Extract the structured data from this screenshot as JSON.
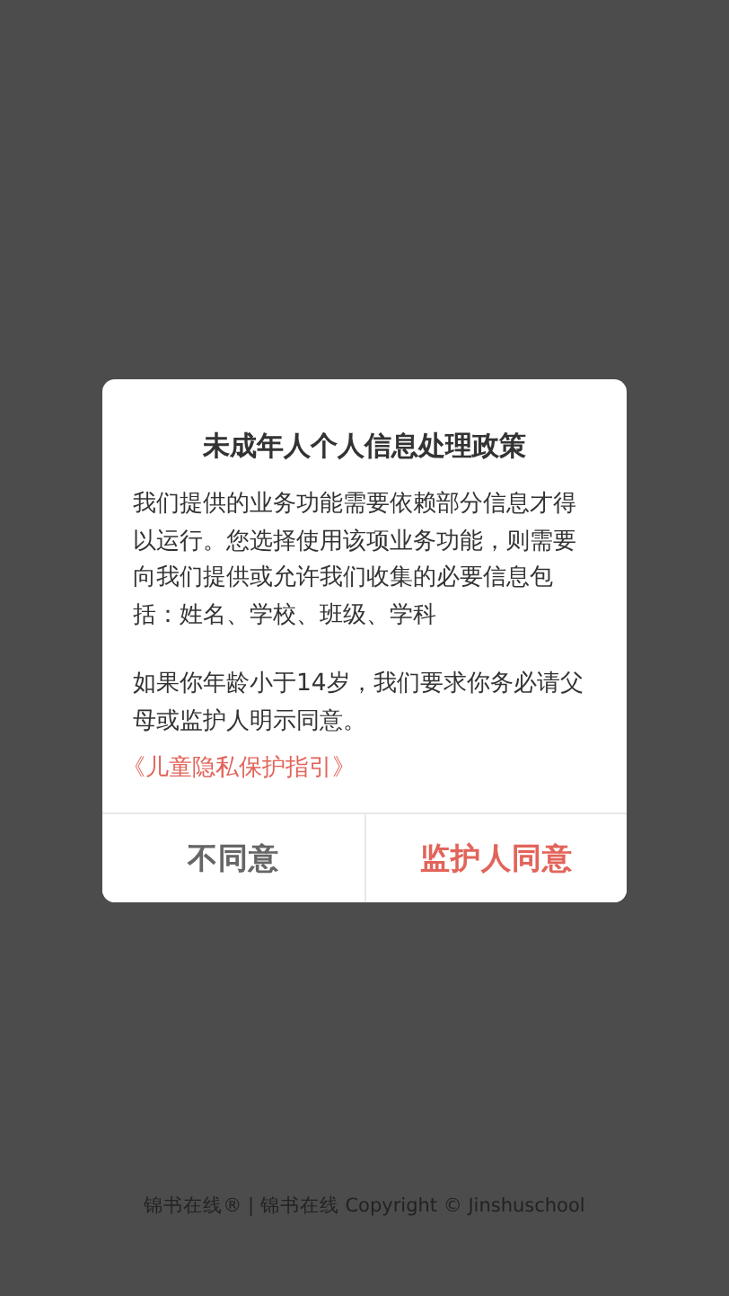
{
  "dialog": {
    "title": "未成年人个人信息处理政策",
    "paragraphs": [
      "我们提供的业务功能需要依赖部分信息才得以运行。您选择使用该项业务功能，则需要向我们提供或允许我们收集的必要信息包括：姓名、学校、班级、学科",
      "如果你年龄小于14岁，我们要求你务必请父母或监护人明示同意。"
    ],
    "link": "《儿童隐私保护指引》",
    "buttons": [
      {
        "label": "不同意",
        "kind": "secondary"
      },
      {
        "label": "监护人同意",
        "kind": "primary"
      }
    ]
  },
  "footer": "锦书在线® | 锦书在线 Copyright © Jinshuschool"
}
